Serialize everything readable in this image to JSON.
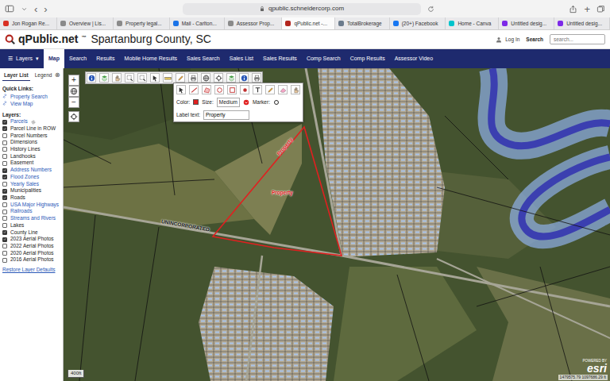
{
  "browser": {
    "back": "‹",
    "forward": "›",
    "url": "qpublic.schneidercorp.com",
    "new_tab": "+"
  },
  "tabs": [
    {
      "label": "Jon Rogan Re...",
      "selected": false,
      "color": "#d93025"
    },
    {
      "label": "Overview | Lis...",
      "selected": false,
      "color": "#8a8a8a"
    },
    {
      "label": "Property legal...",
      "selected": false,
      "color": "#8a8a8a"
    },
    {
      "label": "Mail - Carlton...",
      "selected": false,
      "color": "#1a73e8"
    },
    {
      "label": "Assessor Prop...",
      "selected": false,
      "color": "#8a8a8a"
    },
    {
      "label": "qPublic.net -...",
      "selected": true,
      "color": "#b3261e"
    },
    {
      "label": "TotalBrokerage",
      "selected": false,
      "color": "#6b7b8c"
    },
    {
      "label": "(20+) Facebook",
      "selected": false,
      "color": "#1877f2"
    },
    {
      "label": "Home - Canva",
      "selected": false,
      "color": "#00c4cc"
    },
    {
      "label": "Untitled desig...",
      "selected": false,
      "color": "#7d2ae8"
    },
    {
      "label": "Untitled desig...",
      "selected": false,
      "color": "#7d2ae8"
    }
  ],
  "site": {
    "logo": "qPublic.net",
    "trademark": "™",
    "county": "Spartanburg County, SC",
    "login": "Log In",
    "search_label": "Search",
    "search_placeholder": "search..."
  },
  "nav": {
    "layers_icon": "☰",
    "layers": "Layers",
    "layers_caret": "▾",
    "items": [
      {
        "label": "Map",
        "selected": true
      },
      {
        "label": "Search",
        "selected": false
      },
      {
        "label": "Results",
        "selected": false
      },
      {
        "label": "Mobile Home Results",
        "selected": false
      },
      {
        "label": "Sales Search",
        "selected": false
      },
      {
        "label": "Sales List",
        "selected": false
      },
      {
        "label": "Sales Results",
        "selected": false
      },
      {
        "label": "Comp Search",
        "selected": false
      },
      {
        "label": "Comp Results",
        "selected": false
      },
      {
        "label": "Assessor Video",
        "selected": false
      }
    ]
  },
  "sidebar": {
    "tabs": [
      {
        "label": "Layer List",
        "selected": true
      },
      {
        "label": "Legend",
        "selected": false
      }
    ],
    "close": "⊗",
    "quick_links_title": "Quick Links:",
    "quick_links": [
      "Property Search",
      "View Map"
    ],
    "layers_title": "Layers:",
    "layers": [
      {
        "label": "Parcels",
        "checked": true,
        "kind": "link"
      },
      {
        "label": "Parcel Line in ROW",
        "checked": true,
        "kind": "plain"
      },
      {
        "label": "Parcel Numbers",
        "checked": false,
        "kind": "plain"
      },
      {
        "label": "Dimensions",
        "checked": false,
        "kind": "plain"
      },
      {
        "label": "History Lines",
        "checked": false,
        "kind": "plain"
      },
      {
        "label": "Landhooks",
        "checked": false,
        "kind": "plain"
      },
      {
        "label": "Easement",
        "checked": false,
        "kind": "plain"
      },
      {
        "label": "Address Numbers",
        "checked": true,
        "kind": "link"
      },
      {
        "label": "Flood Zones",
        "checked": true,
        "kind": "link"
      },
      {
        "label": "Yearly Sales",
        "checked": false,
        "kind": "link"
      },
      {
        "label": "Municipalities",
        "checked": true,
        "kind": "plain"
      },
      {
        "label": "Roads",
        "checked": true,
        "kind": "plain"
      },
      {
        "label": "USA Major Highways",
        "checked": false,
        "kind": "link"
      },
      {
        "label": "Railroads",
        "checked": false,
        "kind": "link"
      },
      {
        "label": "Streams and Rivers",
        "checked": false,
        "kind": "link"
      },
      {
        "label": "Lakes",
        "checked": false,
        "kind": "plain"
      },
      {
        "label": "County Line",
        "checked": true,
        "kind": "plain"
      },
      {
        "label": "2023 Aerial Photos",
        "checked": true,
        "kind": "plain"
      },
      {
        "label": "2022 Aerial Photos",
        "checked": false,
        "kind": "plain"
      },
      {
        "label": "2020 Aerial Photos",
        "checked": false,
        "kind": "plain"
      },
      {
        "label": "2016 Aerial Photos",
        "checked": false,
        "kind": "plain"
      }
    ],
    "restore": "Restore Layer Defaults"
  },
  "map": {
    "zoom_in": "+",
    "zoom_out": "−",
    "draw_panel": {
      "color_label": "Color:",
      "color": "#e02020",
      "size_label": "Size:",
      "size": "Medium",
      "marker_label": "Marker:",
      "label_label": "Label text:",
      "label_value": "Property"
    },
    "labels": [
      {
        "text": "UNINCORPORATED",
        "color": "#111111"
      },
      {
        "text": "Property",
        "color": "#e02020"
      },
      {
        "text": "Property",
        "color": "#e02020"
      }
    ],
    "scale": "400ft",
    "attribution": "POWERED BY",
    "esri": "esri",
    "coords": "1479575.79 1097686.29 ft"
  }
}
